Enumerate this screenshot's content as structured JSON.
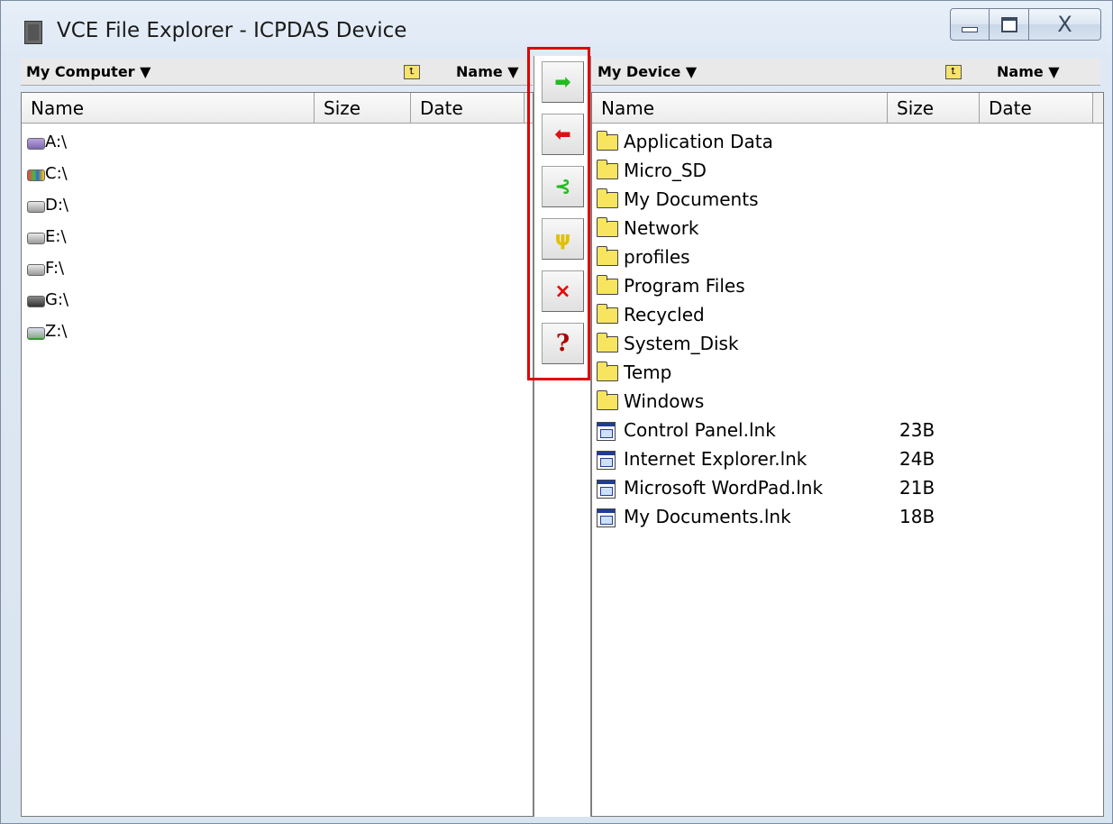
{
  "window": {
    "title": "VCE File Explorer - ICPDAS Device",
    "controls": {
      "minimize": "minimize",
      "maximize": "maximize",
      "close": "X"
    }
  },
  "left_pane": {
    "location": "My Computer ▼",
    "sort": "Name ▼",
    "columns": [
      "Name",
      "Size",
      "Date"
    ],
    "items": [
      {
        "name": "A:\\",
        "icon": "floppy-drive-icon"
      },
      {
        "name": "C:\\",
        "icon": "windows-drive-icon"
      },
      {
        "name": "D:\\",
        "icon": "drive-icon"
      },
      {
        "name": "E:\\",
        "icon": "drive-icon"
      },
      {
        "name": "F:\\",
        "icon": "drive-icon"
      },
      {
        "name": "G:\\",
        "icon": "dvd-drive-icon"
      },
      {
        "name": "Z:\\",
        "icon": "network-drive-icon"
      }
    ]
  },
  "right_pane": {
    "location": "My Device ▼",
    "sort": "Name ▼",
    "columns": [
      "Name",
      "Size",
      "Date"
    ],
    "items": [
      {
        "name": "Application Data",
        "size": "",
        "icon": "folder-icon"
      },
      {
        "name": "Micro_SD",
        "size": "",
        "icon": "folder-icon"
      },
      {
        "name": "My Documents",
        "size": "",
        "icon": "folder-icon"
      },
      {
        "name": "Network",
        "size": "",
        "icon": "folder-icon"
      },
      {
        "name": "profiles",
        "size": "",
        "icon": "folder-icon"
      },
      {
        "name": "Program Files",
        "size": "",
        "icon": "folder-icon"
      },
      {
        "name": "Recycled",
        "size": "",
        "icon": "folder-icon"
      },
      {
        "name": "System_Disk",
        "size": "",
        "icon": "folder-icon"
      },
      {
        "name": "Temp",
        "size": "",
        "icon": "folder-icon"
      },
      {
        "name": "Windows",
        "size": "",
        "icon": "folder-icon"
      },
      {
        "name": "Control Panel.lnk",
        "size": "23B",
        "icon": "shortcut-icon"
      },
      {
        "name": "Internet Explorer.lnk",
        "size": "24B",
        "icon": "shortcut-icon"
      },
      {
        "name": "Microsoft WordPad.lnk",
        "size": "21B",
        "icon": "shortcut-icon"
      },
      {
        "name": "My Documents.lnk",
        "size": "18B",
        "icon": "shortcut-icon"
      }
    ]
  },
  "toolbar": {
    "buttons": [
      {
        "name": "copy-to-device",
        "glyph": "➡",
        "color": "#22bb22",
        "icon": "arrow-right-icon"
      },
      {
        "name": "copy-to-computer",
        "glyph": "⬅",
        "color": "#dd1111",
        "icon": "arrow-left-icon"
      },
      {
        "name": "sync",
        "glyph": "⊰",
        "color": "#22bb22",
        "icon": "sync-icon"
      },
      {
        "name": "settings",
        "glyph": "ψ",
        "color": "#e0c000",
        "icon": "wrench-icon"
      },
      {
        "name": "delete",
        "glyph": "×",
        "color": "#ee0000",
        "icon": "delete-icon"
      },
      {
        "name": "help",
        "glyph": "?",
        "color": "#aa0000",
        "icon": "help-icon"
      }
    ]
  },
  "colors": {
    "highlight": "#e00000",
    "folder": "#f7e560"
  }
}
